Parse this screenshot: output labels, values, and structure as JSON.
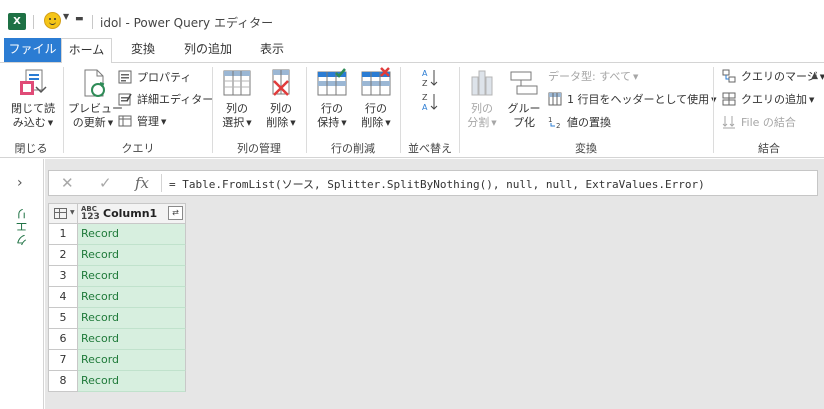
{
  "titlebar": {
    "app_icon": "excel-icon",
    "title": "idol - Power Query エディター"
  },
  "tabs": [
    {
      "label": "ファイル"
    },
    {
      "label": "ホーム"
    },
    {
      "label": "変換"
    },
    {
      "label": "列の追加"
    },
    {
      "label": "表示"
    }
  ],
  "ribbon": {
    "close": {
      "line1": "閉じて読",
      "line2": "み込む",
      "group": "閉じる"
    },
    "query": {
      "preview_line1": "プレビュー",
      "preview_line2": "の更新",
      "properties": "プロパティ",
      "advanced_editor": "詳細エディター",
      "manage": "管理",
      "group": "クエリ"
    },
    "manage_columns": {
      "choose_line1": "列の",
      "choose_line2": "選択",
      "remove_line1": "列の",
      "remove_line2": "削除",
      "group": "列の管理"
    },
    "reduce_rows": {
      "keep_line1": "行の",
      "keep_line2": "保持",
      "remove_line1": "行の",
      "remove_line2": "削除",
      "group": "行の削減"
    },
    "sort": {
      "group": "並べ替え"
    },
    "transform": {
      "split_line1": "列の",
      "split_line2": "分割",
      "group_line1": "グルー",
      "group_line2": "プ化",
      "data_type": "データ型: すべて",
      "first_row_header": "1 行目をヘッダーとして使用",
      "replace_values": "値の置換",
      "group": "変換"
    },
    "combine": {
      "merge_queries": "クエリのマージ",
      "append_queries": "クエリの追加",
      "combine_files": "File の結合",
      "group": "結合"
    }
  },
  "left_pane": {
    "label": "クエリ"
  },
  "formula_bar": {
    "text": "= Table.FromList(ソース, Splitter.SplitByNothing(), null, null, ExtraValues.Error)"
  },
  "grid": {
    "type_label_top": "ABC",
    "type_label_bottom": "123",
    "column_header": "Column1",
    "rows": [
      {
        "num": "1",
        "value": "Record"
      },
      {
        "num": "2",
        "value": "Record"
      },
      {
        "num": "3",
        "value": "Record"
      },
      {
        "num": "4",
        "value": "Record"
      },
      {
        "num": "5",
        "value": "Record"
      },
      {
        "num": "6",
        "value": "Record"
      },
      {
        "num": "7",
        "value": "Record"
      },
      {
        "num": "8",
        "value": "Record"
      }
    ]
  },
  "colors": {
    "accent": "#2b7cd3",
    "excel_green": "#1e7145",
    "record_text": "#1f7a3a",
    "cell_bg": "#d7efdf"
  }
}
